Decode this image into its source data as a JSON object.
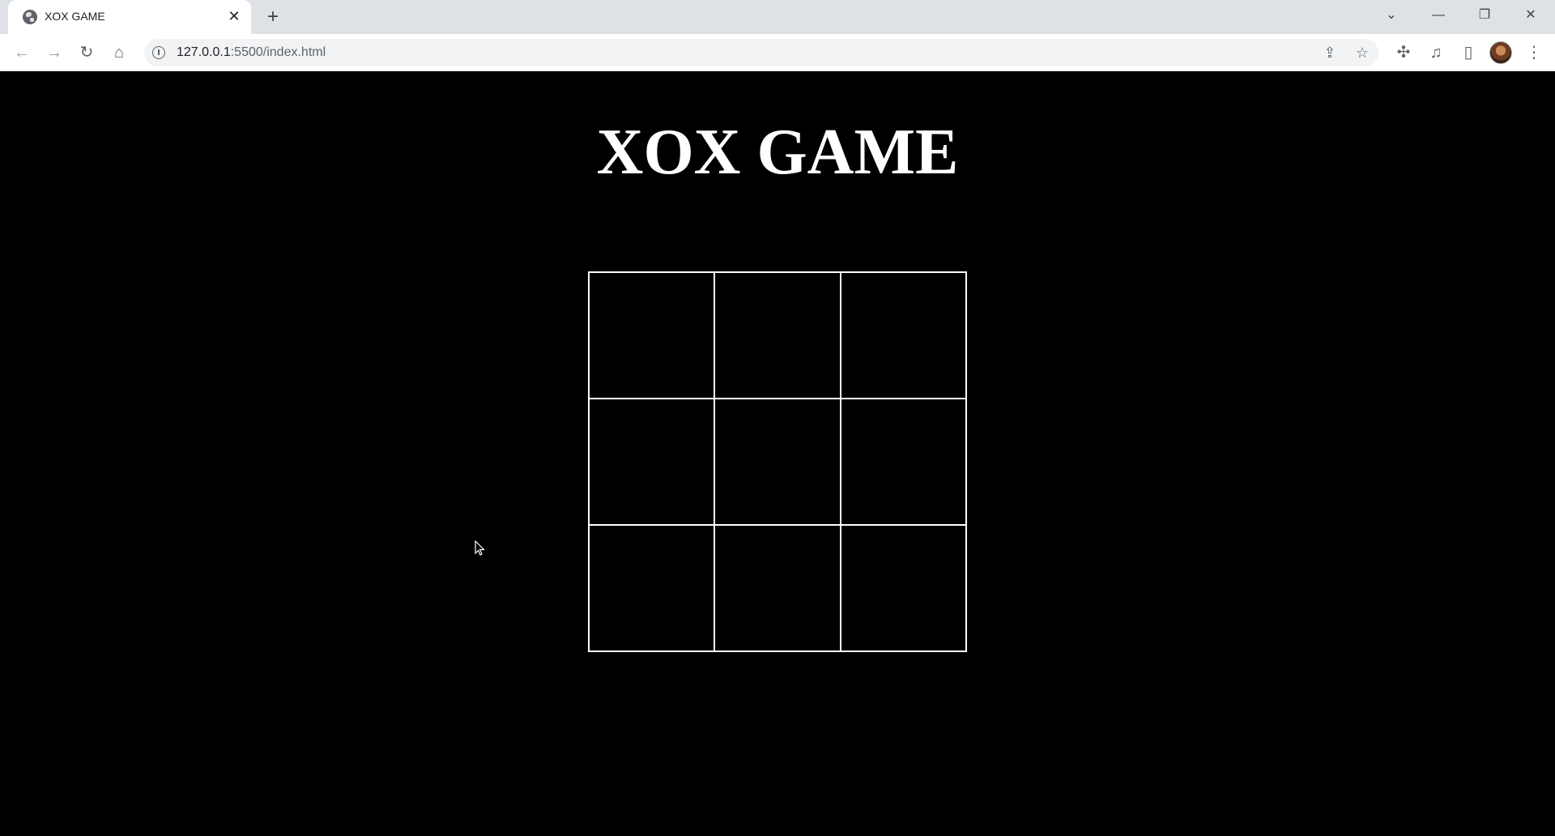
{
  "browser": {
    "tab": {
      "title": "XOX GAME",
      "favicon": "globe-icon",
      "close_glyph": "✕"
    },
    "new_tab_glyph": "+",
    "window_controls": {
      "tab_search": "⌄",
      "minimize": "—",
      "restore": "❐",
      "close": "✕"
    },
    "nav": {
      "back": "←",
      "forward": "→",
      "reload": "↻",
      "home": "⌂"
    },
    "address": {
      "host": "127.0.0.1",
      "path": ":5500/index.html"
    },
    "toolbar_icons": {
      "share": "⇪",
      "bookmark": "☆",
      "extensions": "✣",
      "media": "♫",
      "side_panel": "▯",
      "menu": "⋮"
    }
  },
  "page": {
    "title": "XOX GAME",
    "board": {
      "cells": [
        "",
        "",
        "",
        "",
        "",
        "",
        "",
        "",
        ""
      ]
    }
  },
  "colors": {
    "page_background": "#000000",
    "foreground": "#ffffff",
    "tabbar": "#dee1e6"
  }
}
